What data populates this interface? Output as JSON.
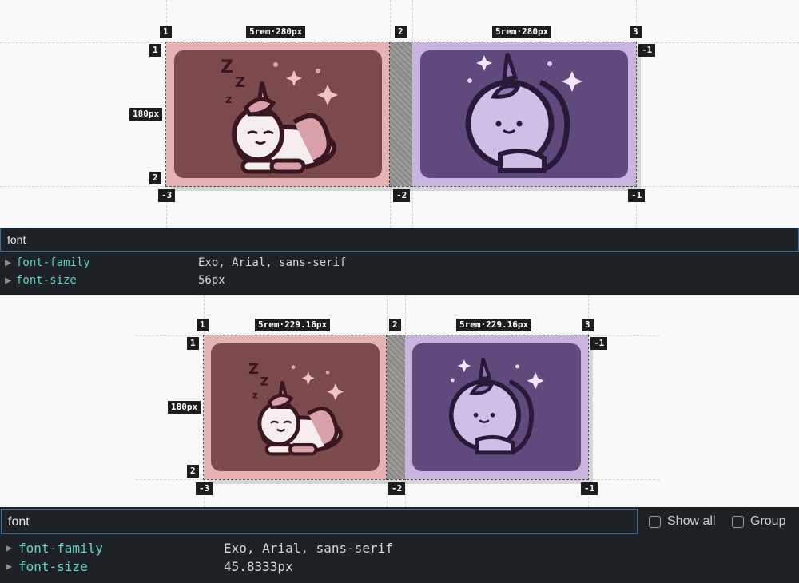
{
  "top": {
    "col_badges": [
      "1",
      "2",
      "3"
    ],
    "row_badges": [
      "1",
      "2"
    ],
    "neg_badges": {
      "right_top": "-1",
      "bottom_left": "-3",
      "bottom_mid": "-2",
      "bottom_right": "-1"
    },
    "col_size_left": "5rem·280px",
    "col_size_right": "5rem·280px",
    "row_size": "180px",
    "filter_value": "font",
    "properties": [
      {
        "name": "font-family",
        "value": "Exo, Arial, sans-serif"
      },
      {
        "name": "font-size",
        "value": "56px"
      }
    ]
  },
  "bottom": {
    "col_badges": [
      "1",
      "2",
      "3"
    ],
    "row_badges": [
      "1",
      "2"
    ],
    "neg_badges": {
      "right_top": "-1",
      "bottom_left": "-3",
      "bottom_mid": "-2",
      "bottom_right": "-1"
    },
    "col_size_left": "5rem·229.16px",
    "col_size_right": "5rem·229.16px",
    "row_size": "180px",
    "filter_value": "font",
    "show_all_label": "Show all",
    "group_label": "Group",
    "properties": [
      {
        "name": "font-family",
        "value": "Exo, Arial, sans-serif"
      },
      {
        "name": "font-size",
        "value": "45.8333px"
      }
    ]
  },
  "icons": {
    "sleeping_unicorn": "sleeping-unicorn-illustration",
    "sitting_unicorn": "sitting-unicorn-illustration",
    "expand": "triangle-right"
  },
  "colors": {
    "pink_track": "#e5b3b3",
    "pink_card": "#7a4a4d",
    "purple_track": "#c8b4de",
    "purple_card": "#5e4a7c",
    "property_name": "#5ed6c6",
    "filter_border": "#3b6e9c"
  }
}
